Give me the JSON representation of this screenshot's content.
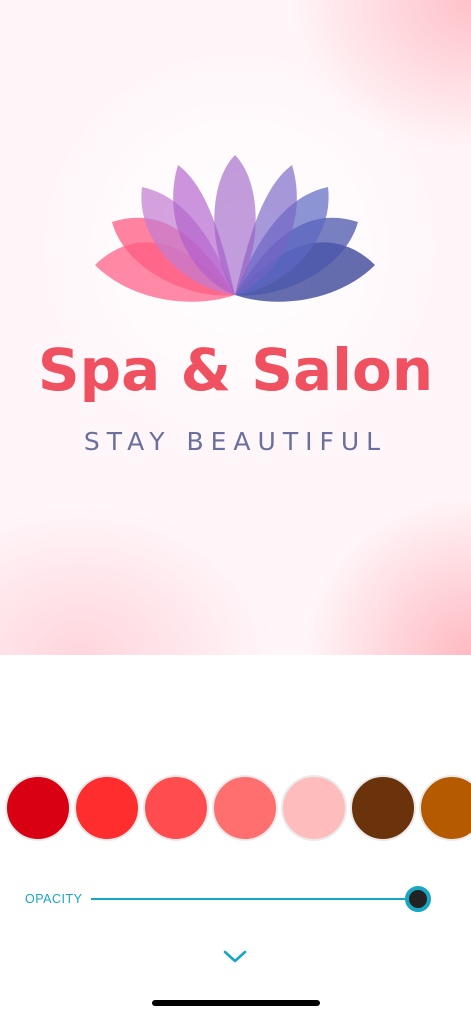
{
  "canvas": {
    "logo": {
      "title": "Spa & Salon",
      "tagline": "STAY BEAUTIFUL"
    }
  },
  "swatches": [
    {
      "color": "#d80012"
    },
    {
      "color": "#ff2d2d"
    },
    {
      "color": "#ff4d4f"
    },
    {
      "color": "#ff6f6f"
    },
    {
      "color": "#ffbcbc"
    },
    {
      "color": "#6a330b"
    },
    {
      "color": "#b55a00"
    }
  ],
  "opacity": {
    "label": "OPACITY",
    "value": 1.0
  },
  "icons": {
    "collapse": "chevron-down-icon"
  },
  "colors": {
    "accent": "#17a6c4",
    "title": "#f05160",
    "tagline": "#6b6f9e"
  }
}
